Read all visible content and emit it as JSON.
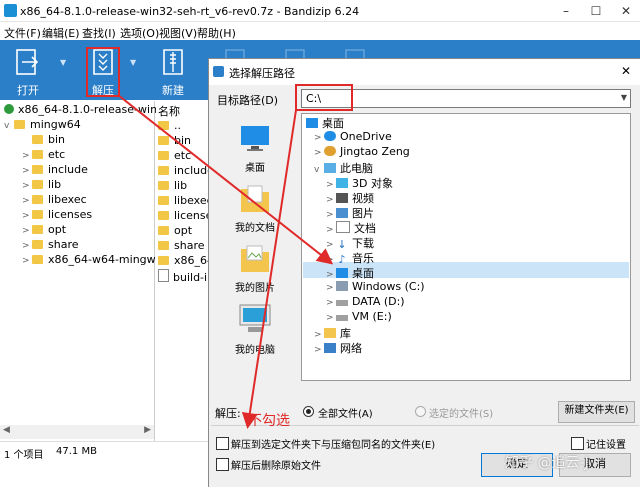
{
  "window": {
    "title": "x86_64-8.1.0-release-win32-seh-rt_v6-rev0.7z - Bandizip 6.24",
    "controls": [
      "–",
      "☐",
      "✕"
    ]
  },
  "menu": [
    "文件(F)",
    "编辑(E)",
    "查找(I)",
    "选项(O)",
    "视图(V)",
    "帮助(H)"
  ],
  "toolbar": {
    "open": "打开",
    "extract": "解压",
    "new": "新建"
  },
  "tree": {
    "root": "x86_64-8.1.0-release-win32-s",
    "child": "mingw64",
    "items": [
      "bin",
      "etc",
      "include",
      "lib",
      "libexec",
      "licenses",
      "opt",
      "share",
      "x86_64-w64-mingw32"
    ]
  },
  "list": {
    "header": "名称",
    "items": [
      "..",
      "bin",
      "etc",
      "include",
      "lib",
      "libexec",
      "licenses",
      "opt",
      "share",
      "x86_64-",
      "build-in"
    ]
  },
  "status": {
    "items": "1 个项目",
    "size": "47.1 MB"
  },
  "dialog": {
    "title": "选择解压路径",
    "target_label": "目标路径(D)",
    "path_value": "C:\\",
    "places": [
      "桌面",
      "我的文档",
      "我的图片",
      "我的电脑"
    ],
    "tree": [
      {
        "label": "桌面",
        "level": 0,
        "expand": ""
      },
      {
        "label": "OneDrive",
        "level": 1,
        "expand": ">"
      },
      {
        "label": "Jingtao Zeng",
        "level": 1,
        "expand": ">"
      },
      {
        "label": "此电脑",
        "level": 1,
        "expand": "v"
      },
      {
        "label": "3D 对象",
        "level": 2,
        "expand": ">"
      },
      {
        "label": "视频",
        "level": 2,
        "expand": ">"
      },
      {
        "label": "图片",
        "level": 2,
        "expand": ">"
      },
      {
        "label": "文档",
        "level": 2,
        "expand": ">"
      },
      {
        "label": "下载",
        "level": 2,
        "expand": ">"
      },
      {
        "label": "音乐",
        "level": 2,
        "expand": ">"
      },
      {
        "label": "桌面",
        "level": 2,
        "expand": ">"
      },
      {
        "label": "Windows (C:)",
        "level": 2,
        "expand": ">"
      },
      {
        "label": "DATA (D:)",
        "level": 2,
        "expand": ">"
      },
      {
        "label": "VM (E:)",
        "level": 2,
        "expand": ">"
      },
      {
        "label": "库",
        "level": 1,
        "expand": ">"
      },
      {
        "label": "网络",
        "level": 1,
        "expand": ">"
      }
    ],
    "selected_index": 11,
    "extract_label": "解压:",
    "radio_all": "全部文件(A)",
    "radio_selected": "选定的文件(S)",
    "new_folder": "新建文件夹(E)",
    "option1": "解压到选定文件夹下与压缩包同名的文件夹(E)",
    "option2": "解压后删除原始文件",
    "remember": "记住设置",
    "ok": "确定",
    "cancel": "取消"
  },
  "annotation": {
    "text": "不勾选",
    "watermark": "知乎 @追云-J"
  }
}
